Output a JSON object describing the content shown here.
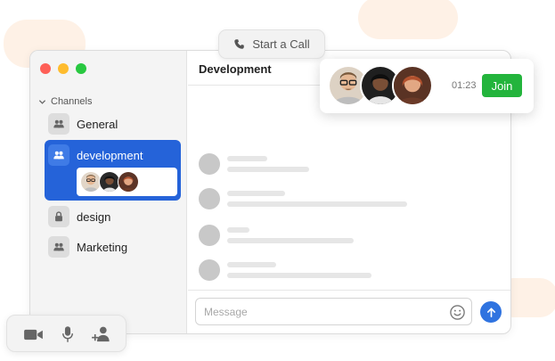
{
  "call_button": {
    "label": "Start a Call",
    "icon": "phone-icon"
  },
  "sidebar": {
    "section_label": "Channels",
    "channels": [
      {
        "label": "General",
        "icon": "people-icon",
        "active": false
      },
      {
        "label": "development",
        "icon": "people-icon",
        "active": true
      },
      {
        "label": "design",
        "icon": "lock-icon",
        "active": false
      },
      {
        "label": "Marketing",
        "icon": "people-icon",
        "active": false
      }
    ]
  },
  "main": {
    "title": "Development"
  },
  "call_card": {
    "timer": "01:23",
    "join_label": "Join"
  },
  "composer": {
    "placeholder": "Message",
    "emoji_icon": "smiley-icon",
    "send_icon": "arrow-up-icon"
  },
  "media_controls": [
    "camera-icon",
    "microphone-icon",
    "add-user-icon"
  ],
  "colors": {
    "accent": "#2563d9",
    "join": "#23b43c",
    "send": "#2f73e0",
    "window_close": "#fe5f57",
    "window_minimize": "#febc2e",
    "window_maximize": "#28c840",
    "decor": "#fef1e6"
  }
}
